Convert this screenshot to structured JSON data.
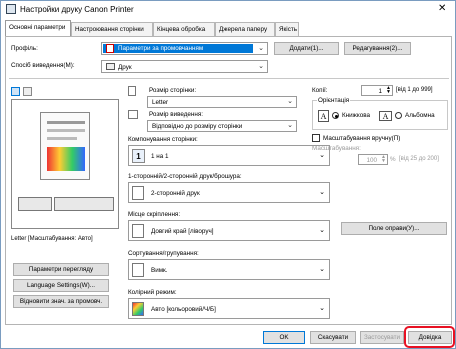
{
  "window": {
    "title": "Настройки друку Canon Printer",
    "close": "✕"
  },
  "tabs": [
    "Основні параметри",
    "Настроювання сторінки",
    "Кінцева обробка",
    "Джерела паперу",
    "Якість"
  ],
  "profile": {
    "label": "Профіль:",
    "value": "Параметри за промовчанням",
    "add": "Додати(1)...",
    "edit": "Редагування(2)..."
  },
  "output": {
    "label": "Спосіб виведення(M):",
    "value": "Друк"
  },
  "page_size": {
    "label": "Розмір сторінки:",
    "value": "Letter"
  },
  "output_size": {
    "label": "Розмір виведення:",
    "value": "Відповідно до розміру сторінки"
  },
  "copies": {
    "label": "Копії:",
    "value": "1",
    "range": "[від 1 до 999]"
  },
  "orientation": {
    "label": "Орієнтація",
    "portrait": "Книжкова",
    "landscape": "Альбомна"
  },
  "manual_scaling": {
    "label": "Масштабування вручну(П)",
    "sub": "Масштабування:",
    "value": "100",
    "unit": "%",
    "range": "[від 25 до 200]"
  },
  "layout": {
    "label": "Компонування сторінки:",
    "icon": "1",
    "value": "1 на 1"
  },
  "duplex": {
    "label": "1-сторонній/2-сторонній друк/брошура:",
    "value": "2-сторонній друк"
  },
  "binding": {
    "label": "Місце скріплення:",
    "value": "Довгий край [ліворуч]",
    "margin_btn": "Поле оправи(У)..."
  },
  "collate": {
    "label": "Сортування/групування:",
    "value": "Вимк."
  },
  "color": {
    "label": "Колірний режим:",
    "value": "Авто [кольоровий/Ч/Б]"
  },
  "preview": {
    "caption": "Letter [Масштабування: Авто]"
  },
  "left_buttons": [
    "Параметри перегляду",
    "Language Settings(W)...",
    "Відновити знач. за промовч."
  ],
  "footer": {
    "ok": "OK",
    "cancel": "Скасувати",
    "apply": "Застосувати",
    "help": "Довідка"
  },
  "colors": {
    "accent": "#0078d7",
    "highlight": "#e81123"
  }
}
